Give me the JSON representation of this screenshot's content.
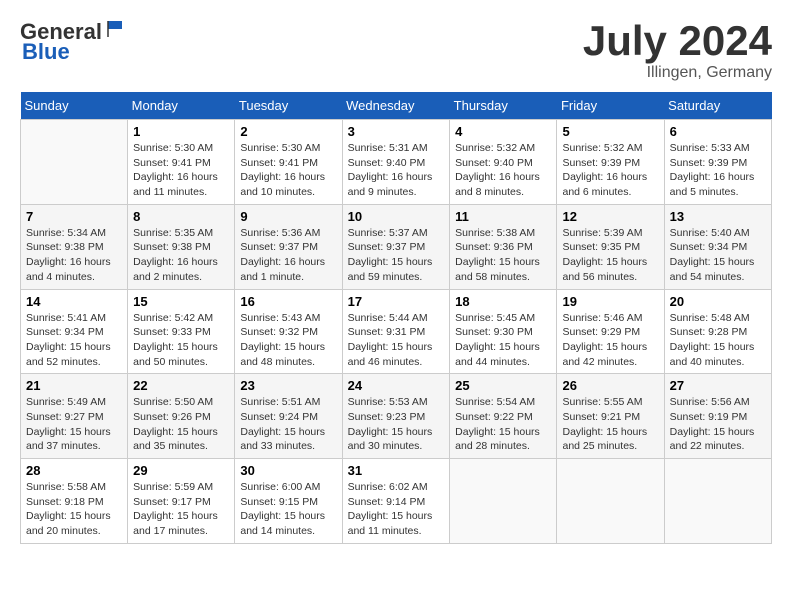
{
  "header": {
    "logo_general": "General",
    "logo_blue": "Blue",
    "month_title": "July 2024",
    "location": "Illingen, Germany"
  },
  "days_of_week": [
    "Sunday",
    "Monday",
    "Tuesday",
    "Wednesday",
    "Thursday",
    "Friday",
    "Saturday"
  ],
  "weeks": [
    [
      {
        "day": "",
        "info": ""
      },
      {
        "day": "1",
        "info": "Sunrise: 5:30 AM\nSunset: 9:41 PM\nDaylight: 16 hours\nand 11 minutes."
      },
      {
        "day": "2",
        "info": "Sunrise: 5:30 AM\nSunset: 9:41 PM\nDaylight: 16 hours\nand 10 minutes."
      },
      {
        "day": "3",
        "info": "Sunrise: 5:31 AM\nSunset: 9:40 PM\nDaylight: 16 hours\nand 9 minutes."
      },
      {
        "day": "4",
        "info": "Sunrise: 5:32 AM\nSunset: 9:40 PM\nDaylight: 16 hours\nand 8 minutes."
      },
      {
        "day": "5",
        "info": "Sunrise: 5:32 AM\nSunset: 9:39 PM\nDaylight: 16 hours\nand 6 minutes."
      },
      {
        "day": "6",
        "info": "Sunrise: 5:33 AM\nSunset: 9:39 PM\nDaylight: 16 hours\nand 5 minutes."
      }
    ],
    [
      {
        "day": "7",
        "info": "Sunrise: 5:34 AM\nSunset: 9:38 PM\nDaylight: 16 hours\nand 4 minutes."
      },
      {
        "day": "8",
        "info": "Sunrise: 5:35 AM\nSunset: 9:38 PM\nDaylight: 16 hours\nand 2 minutes."
      },
      {
        "day": "9",
        "info": "Sunrise: 5:36 AM\nSunset: 9:37 PM\nDaylight: 16 hours\nand 1 minute."
      },
      {
        "day": "10",
        "info": "Sunrise: 5:37 AM\nSunset: 9:37 PM\nDaylight: 15 hours\nand 59 minutes."
      },
      {
        "day": "11",
        "info": "Sunrise: 5:38 AM\nSunset: 9:36 PM\nDaylight: 15 hours\nand 58 minutes."
      },
      {
        "day": "12",
        "info": "Sunrise: 5:39 AM\nSunset: 9:35 PM\nDaylight: 15 hours\nand 56 minutes."
      },
      {
        "day": "13",
        "info": "Sunrise: 5:40 AM\nSunset: 9:34 PM\nDaylight: 15 hours\nand 54 minutes."
      }
    ],
    [
      {
        "day": "14",
        "info": "Sunrise: 5:41 AM\nSunset: 9:34 PM\nDaylight: 15 hours\nand 52 minutes."
      },
      {
        "day": "15",
        "info": "Sunrise: 5:42 AM\nSunset: 9:33 PM\nDaylight: 15 hours\nand 50 minutes."
      },
      {
        "day": "16",
        "info": "Sunrise: 5:43 AM\nSunset: 9:32 PM\nDaylight: 15 hours\nand 48 minutes."
      },
      {
        "day": "17",
        "info": "Sunrise: 5:44 AM\nSunset: 9:31 PM\nDaylight: 15 hours\nand 46 minutes."
      },
      {
        "day": "18",
        "info": "Sunrise: 5:45 AM\nSunset: 9:30 PM\nDaylight: 15 hours\nand 44 minutes."
      },
      {
        "day": "19",
        "info": "Sunrise: 5:46 AM\nSunset: 9:29 PM\nDaylight: 15 hours\nand 42 minutes."
      },
      {
        "day": "20",
        "info": "Sunrise: 5:48 AM\nSunset: 9:28 PM\nDaylight: 15 hours\nand 40 minutes."
      }
    ],
    [
      {
        "day": "21",
        "info": "Sunrise: 5:49 AM\nSunset: 9:27 PM\nDaylight: 15 hours\nand 37 minutes."
      },
      {
        "day": "22",
        "info": "Sunrise: 5:50 AM\nSunset: 9:26 PM\nDaylight: 15 hours\nand 35 minutes."
      },
      {
        "day": "23",
        "info": "Sunrise: 5:51 AM\nSunset: 9:24 PM\nDaylight: 15 hours\nand 33 minutes."
      },
      {
        "day": "24",
        "info": "Sunrise: 5:53 AM\nSunset: 9:23 PM\nDaylight: 15 hours\nand 30 minutes."
      },
      {
        "day": "25",
        "info": "Sunrise: 5:54 AM\nSunset: 9:22 PM\nDaylight: 15 hours\nand 28 minutes."
      },
      {
        "day": "26",
        "info": "Sunrise: 5:55 AM\nSunset: 9:21 PM\nDaylight: 15 hours\nand 25 minutes."
      },
      {
        "day": "27",
        "info": "Sunrise: 5:56 AM\nSunset: 9:19 PM\nDaylight: 15 hours\nand 22 minutes."
      }
    ],
    [
      {
        "day": "28",
        "info": "Sunrise: 5:58 AM\nSunset: 9:18 PM\nDaylight: 15 hours\nand 20 minutes."
      },
      {
        "day": "29",
        "info": "Sunrise: 5:59 AM\nSunset: 9:17 PM\nDaylight: 15 hours\nand 17 minutes."
      },
      {
        "day": "30",
        "info": "Sunrise: 6:00 AM\nSunset: 9:15 PM\nDaylight: 15 hours\nand 14 minutes."
      },
      {
        "day": "31",
        "info": "Sunrise: 6:02 AM\nSunset: 9:14 PM\nDaylight: 15 hours\nand 11 minutes."
      },
      {
        "day": "",
        "info": ""
      },
      {
        "day": "",
        "info": ""
      },
      {
        "day": "",
        "info": ""
      }
    ]
  ]
}
